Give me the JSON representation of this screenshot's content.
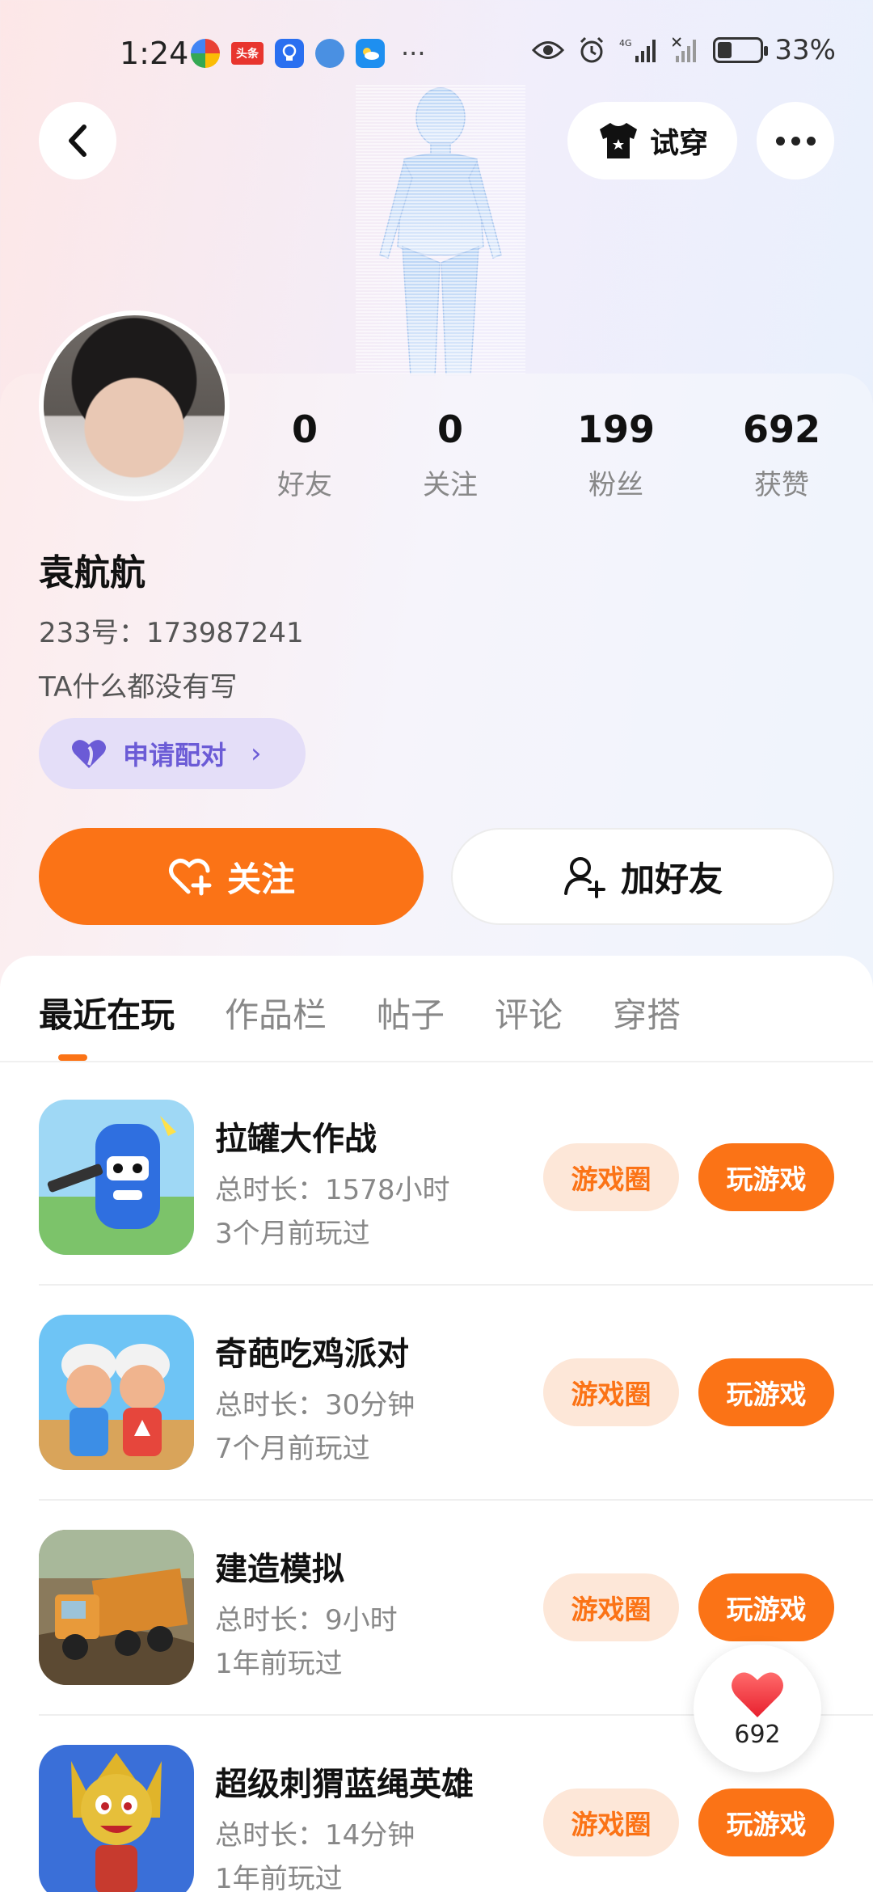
{
  "status_bar": {
    "time": "1:24",
    "battery": "33%",
    "battery_level": 0.33,
    "app_badges": [
      "头条"
    ],
    "network": "4G"
  },
  "header": {
    "tryon_label": "试穿"
  },
  "profile": {
    "stats": [
      {
        "value": "0",
        "label": "好友"
      },
      {
        "value": "0",
        "label": "关注"
      },
      {
        "value": "199",
        "label": "粉丝"
      },
      {
        "value": "692",
        "label": "获赞"
      }
    ],
    "name": "袁航航",
    "uid": "233号：173987241",
    "bio": "TA什么都没有写",
    "match_label": "申请配对",
    "follow_label": "关注",
    "add_friend_label": "加好友"
  },
  "tabs": [
    {
      "label": "最近在玩",
      "active": true
    },
    {
      "label": "作品栏",
      "active": false
    },
    {
      "label": "帖子",
      "active": false
    },
    {
      "label": "评论",
      "active": false
    },
    {
      "label": "穿搭",
      "active": false
    }
  ],
  "games": [
    {
      "name": "拉罐大作战",
      "duration": "总时长：1578小时",
      "last_played": "3个月前玩过",
      "circle_label": "游戏圈",
      "play_label": "玩游戏"
    },
    {
      "name": "奇葩吃鸡派对",
      "duration": "总时长：30分钟",
      "last_played": "7个月前玩过",
      "circle_label": "游戏圈",
      "play_label": "玩游戏"
    },
    {
      "name": "建造模拟",
      "duration": "总时长：9小时",
      "last_played": "1年前玩过",
      "circle_label": "游戏圈",
      "play_label": "玩游戏"
    },
    {
      "name": "超级刺猬蓝绳英雄",
      "duration": "总时长：14分钟",
      "last_played": "1年前玩过",
      "circle_label": "游戏圈",
      "play_label": "玩游戏"
    }
  ],
  "like_float": {
    "count": "692"
  },
  "colors": {
    "accent": "#fb7316",
    "match_purple": "#6b5bd6"
  }
}
